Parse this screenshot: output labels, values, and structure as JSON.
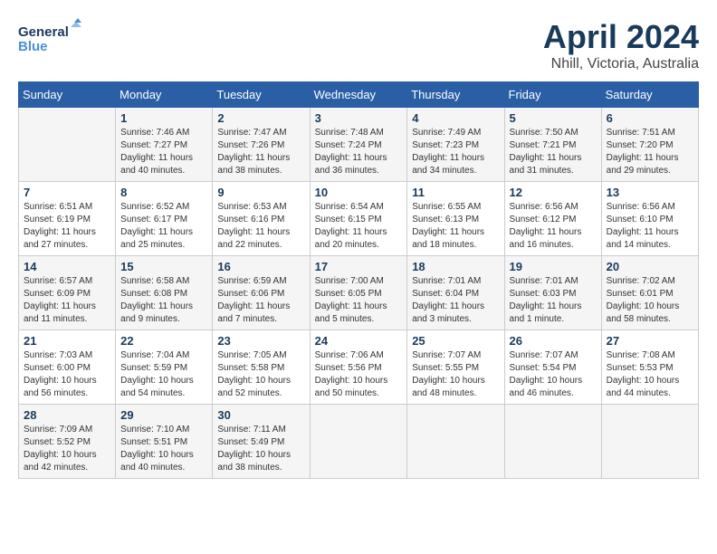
{
  "header": {
    "logo_line1": "General",
    "logo_line2": "Blue",
    "month": "April 2024",
    "location": "Nhill, Victoria, Australia"
  },
  "weekdays": [
    "Sunday",
    "Monday",
    "Tuesday",
    "Wednesday",
    "Thursday",
    "Friday",
    "Saturday"
  ],
  "weeks": [
    [
      {
        "day": "",
        "detail": ""
      },
      {
        "day": "1",
        "detail": "Sunrise: 7:46 AM\nSunset: 7:27 PM\nDaylight: 11 hours\nand 40 minutes."
      },
      {
        "day": "2",
        "detail": "Sunrise: 7:47 AM\nSunset: 7:26 PM\nDaylight: 11 hours\nand 38 minutes."
      },
      {
        "day": "3",
        "detail": "Sunrise: 7:48 AM\nSunset: 7:24 PM\nDaylight: 11 hours\nand 36 minutes."
      },
      {
        "day": "4",
        "detail": "Sunrise: 7:49 AM\nSunset: 7:23 PM\nDaylight: 11 hours\nand 34 minutes."
      },
      {
        "day": "5",
        "detail": "Sunrise: 7:50 AM\nSunset: 7:21 PM\nDaylight: 11 hours\nand 31 minutes."
      },
      {
        "day": "6",
        "detail": "Sunrise: 7:51 AM\nSunset: 7:20 PM\nDaylight: 11 hours\nand 29 minutes."
      }
    ],
    [
      {
        "day": "7",
        "detail": "Sunrise: 6:51 AM\nSunset: 6:19 PM\nDaylight: 11 hours\nand 27 minutes."
      },
      {
        "day": "8",
        "detail": "Sunrise: 6:52 AM\nSunset: 6:17 PM\nDaylight: 11 hours\nand 25 minutes."
      },
      {
        "day": "9",
        "detail": "Sunrise: 6:53 AM\nSunset: 6:16 PM\nDaylight: 11 hours\nand 22 minutes."
      },
      {
        "day": "10",
        "detail": "Sunrise: 6:54 AM\nSunset: 6:15 PM\nDaylight: 11 hours\nand 20 minutes."
      },
      {
        "day": "11",
        "detail": "Sunrise: 6:55 AM\nSunset: 6:13 PM\nDaylight: 11 hours\nand 18 minutes."
      },
      {
        "day": "12",
        "detail": "Sunrise: 6:56 AM\nSunset: 6:12 PM\nDaylight: 11 hours\nand 16 minutes."
      },
      {
        "day": "13",
        "detail": "Sunrise: 6:56 AM\nSunset: 6:10 PM\nDaylight: 11 hours\nand 14 minutes."
      }
    ],
    [
      {
        "day": "14",
        "detail": "Sunrise: 6:57 AM\nSunset: 6:09 PM\nDaylight: 11 hours\nand 11 minutes."
      },
      {
        "day": "15",
        "detail": "Sunrise: 6:58 AM\nSunset: 6:08 PM\nDaylight: 11 hours\nand 9 minutes."
      },
      {
        "day": "16",
        "detail": "Sunrise: 6:59 AM\nSunset: 6:06 PM\nDaylight: 11 hours\nand 7 minutes."
      },
      {
        "day": "17",
        "detail": "Sunrise: 7:00 AM\nSunset: 6:05 PM\nDaylight: 11 hours\nand 5 minutes."
      },
      {
        "day": "18",
        "detail": "Sunrise: 7:01 AM\nSunset: 6:04 PM\nDaylight: 11 hours\nand 3 minutes."
      },
      {
        "day": "19",
        "detail": "Sunrise: 7:01 AM\nSunset: 6:03 PM\nDaylight: 11 hours\nand 1 minute."
      },
      {
        "day": "20",
        "detail": "Sunrise: 7:02 AM\nSunset: 6:01 PM\nDaylight: 10 hours\nand 58 minutes."
      }
    ],
    [
      {
        "day": "21",
        "detail": "Sunrise: 7:03 AM\nSunset: 6:00 PM\nDaylight: 10 hours\nand 56 minutes."
      },
      {
        "day": "22",
        "detail": "Sunrise: 7:04 AM\nSunset: 5:59 PM\nDaylight: 10 hours\nand 54 minutes."
      },
      {
        "day": "23",
        "detail": "Sunrise: 7:05 AM\nSunset: 5:58 PM\nDaylight: 10 hours\nand 52 minutes."
      },
      {
        "day": "24",
        "detail": "Sunrise: 7:06 AM\nSunset: 5:56 PM\nDaylight: 10 hours\nand 50 minutes."
      },
      {
        "day": "25",
        "detail": "Sunrise: 7:07 AM\nSunset: 5:55 PM\nDaylight: 10 hours\nand 48 minutes."
      },
      {
        "day": "26",
        "detail": "Sunrise: 7:07 AM\nSunset: 5:54 PM\nDaylight: 10 hours\nand 46 minutes."
      },
      {
        "day": "27",
        "detail": "Sunrise: 7:08 AM\nSunset: 5:53 PM\nDaylight: 10 hours\nand 44 minutes."
      }
    ],
    [
      {
        "day": "28",
        "detail": "Sunrise: 7:09 AM\nSunset: 5:52 PM\nDaylight: 10 hours\nand 42 minutes."
      },
      {
        "day": "29",
        "detail": "Sunrise: 7:10 AM\nSunset: 5:51 PM\nDaylight: 10 hours\nand 40 minutes."
      },
      {
        "day": "30",
        "detail": "Sunrise: 7:11 AM\nSunset: 5:49 PM\nDaylight: 10 hours\nand 38 minutes."
      },
      {
        "day": "",
        "detail": ""
      },
      {
        "day": "",
        "detail": ""
      },
      {
        "day": "",
        "detail": ""
      },
      {
        "day": "",
        "detail": ""
      }
    ]
  ]
}
